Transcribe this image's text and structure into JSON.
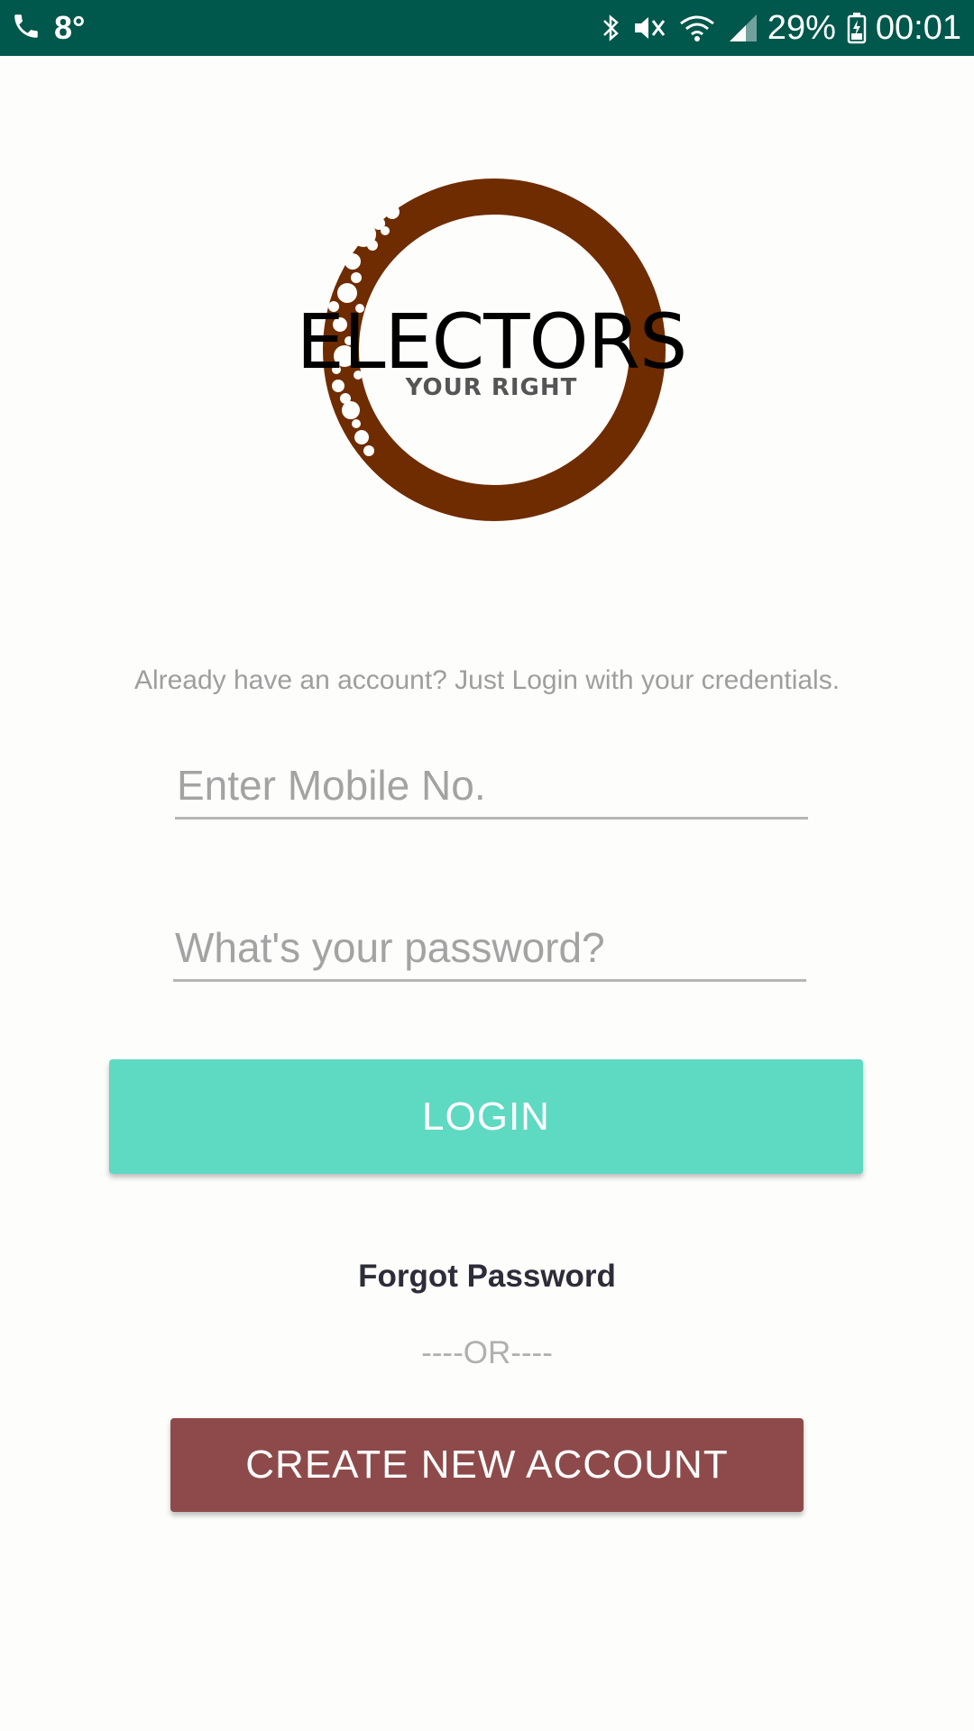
{
  "status_bar": {
    "temperature": "8°",
    "battery": "29%",
    "time": "00:01",
    "icons": [
      "phone-icon",
      "bluetooth-icon",
      "mute-icon",
      "wifi-icon",
      "signal-icon",
      "battery-icon"
    ]
  },
  "logo": {
    "word": "ELECTORS",
    "tagline": "YOUR RIGHT",
    "ring_color": "#6f2c00"
  },
  "login": {
    "subtitle": "Already have an account? Just Login with your credentials.",
    "mobile_placeholder": "Enter Mobile No.",
    "password_placeholder": "What's your password?",
    "login_label": "LOGIN",
    "forgot_label": "Forgot Password",
    "or_label": "----OR----",
    "create_label": "CREATE NEW ACCOUNT"
  },
  "colors": {
    "status_bar": "#00574b",
    "login_button": "#5ed9c2",
    "create_button": "#8e4a4a"
  }
}
